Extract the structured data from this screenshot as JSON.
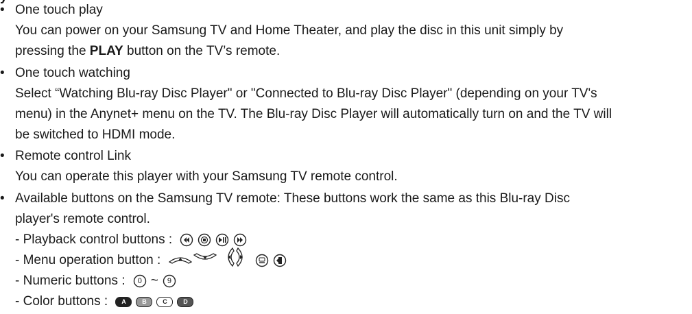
{
  "top_fragment": "y",
  "bullet_symbol": "•",
  "items": [
    {
      "title": "One touch play",
      "lines": [
        "You can power on your Samsung TV and Home Theater, and play the disc in this unit simply by",
        {
          "before": "pressing the ",
          "bold": "PLAY",
          "after": " button on the TV’s remote."
        }
      ]
    },
    {
      "title": "One touch watching",
      "lines": [
        "Select “Watching Blu-ray Disc Player\" or \"Connected to Blu-ray Disc Player\" (depending on your TV's",
        "menu) in the Anynet+ menu on the TV. The Blu-ray Disc Player will automatically turn on and the TV will",
        "be switched to HDMI mode."
      ]
    },
    {
      "title": "Remote control Link",
      "lines": [
        "You can operate this player with your Samsung TV remote control."
      ]
    },
    {
      "title_lines": [
        "Available buttons on the Samsung TV remote: These buttons work the same as this Blu-ray Disc",
        "player's remote control."
      ]
    }
  ],
  "sub_items": [
    {
      "label": "- Playback control buttons : ",
      "icons": [
        "rewind-button-icon",
        "stop-button-icon",
        "play-pause-button-icon",
        "fast-forward-button-icon"
      ]
    },
    {
      "label": "- Menu operation button : ",
      "icons": [
        "up-arrow-button-icon",
        "down-arrow-button-icon",
        "left-arrow-button-icon",
        "right-arrow-button-icon",
        "enter-button-icon",
        "return-button-icon"
      ]
    },
    {
      "label": "- Numeric buttons : ",
      "first": "0",
      "tilde": "~",
      "last": "9"
    },
    {
      "label": "- Color buttons : ",
      "colors": [
        "A",
        "B",
        "C",
        "D"
      ]
    }
  ]
}
